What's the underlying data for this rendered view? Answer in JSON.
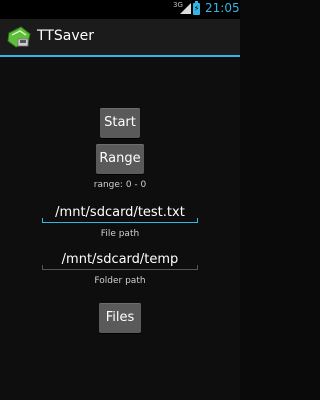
{
  "status_bar": {
    "network": "3G",
    "time": "21:05",
    "colors": {
      "accent": "#33b5e5"
    }
  },
  "action_bar": {
    "title": "TTSaver",
    "icon": "ttsaver-app-icon"
  },
  "main": {
    "start_label": "Start",
    "range_label": "Range",
    "range_status": "range: 0 - 0",
    "file_path_value": "/mnt/sdcard/test.txt",
    "file_path_caption": "File path",
    "folder_path_value": "/mnt/sdcard/temp",
    "folder_path_caption": "Folder path",
    "files_label": "Files"
  }
}
